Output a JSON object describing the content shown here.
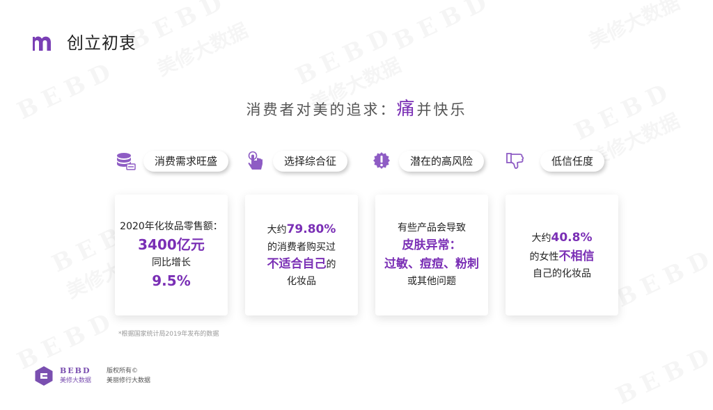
{
  "header": {
    "title": "创立初衷"
  },
  "subtitle": {
    "prefix": "消费者对美的追求：",
    "highlight": "痛",
    "suffix": "并快乐"
  },
  "tags": [
    {
      "label": "消费需求旺盛",
      "icon": "database-icon"
    },
    {
      "label": "选择综合征",
      "icon": "pointer-hand-icon"
    },
    {
      "label": "潜在的高风险",
      "icon": "warning-icon"
    },
    {
      "label": "低信任度",
      "icon": "thumbs-down-icon"
    }
  ],
  "cards": [
    {
      "line1": "2020年化妆品零售额：",
      "value1": "3400亿元",
      "line2": "同比增长",
      "value2": "9.5%"
    },
    {
      "prefix": "大约",
      "value": "79.80%",
      "line2": "的消费者购买过",
      "emph": "不适合自己",
      "emph_suffix": "的",
      "line3": "化妆品"
    },
    {
      "line1": "有些产品会导致",
      "emph1": "皮肤异常：",
      "emph2": "过敏、痘痘、粉刺",
      "line2": "或其他问题"
    },
    {
      "prefix": "大约",
      "value": "40.8%",
      "line2_prefix": "的女性",
      "emph": "不相信",
      "line3": "自己的化妆品"
    }
  ],
  "footnote": "*根据国家统计局2019年发布的数据",
  "footer": {
    "brand_en": "BEBD",
    "brand_cn": "美修大数据",
    "copyright": "版权所有©",
    "company": "美丽修行大数据"
  },
  "watermark": {
    "en": "BEBD",
    "cn": "美修大数据"
  },
  "colors": {
    "accent": "#7a2fb5",
    "icon": "#8e5cc4"
  }
}
